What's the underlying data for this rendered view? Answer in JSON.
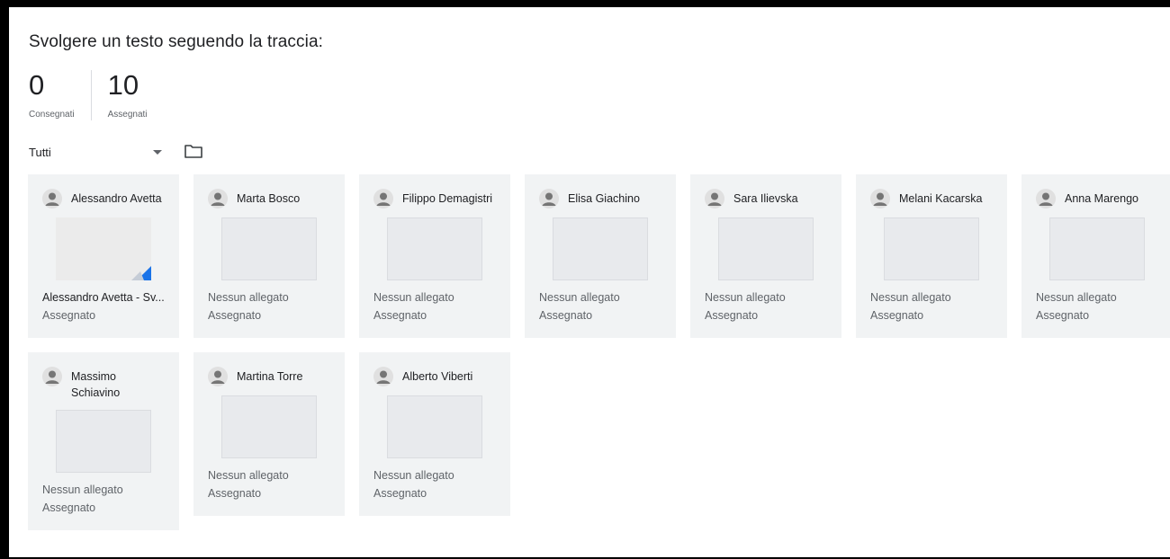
{
  "assignment": {
    "title": "Svolgere un testo seguendo la traccia:"
  },
  "stats": {
    "submitted": {
      "value": "0",
      "label": "Consegnati"
    },
    "assigned": {
      "value": "10",
      "label": "Assegnati"
    }
  },
  "filter": {
    "selected": "Tutti"
  },
  "students": [
    {
      "name": "Alessandro Avetta",
      "line1": "Alessandro Avetta - Sv...",
      "line2": "Assegnato",
      "has_doc": true
    },
    {
      "name": "Marta Bosco",
      "line1": "Nessun allegato",
      "line2": "Assegnato"
    },
    {
      "name": "Filippo Demagistri",
      "line1": "Nessun allegato",
      "line2": "Assegnato"
    },
    {
      "name": "Elisa Giachino",
      "line1": "Nessun allegato",
      "line2": "Assegnato"
    },
    {
      "name": "Sara Ilievska",
      "line1": "Nessun allegato",
      "line2": "Assegnato"
    },
    {
      "name": "Melani Kacarska",
      "line1": "Nessun allegato",
      "line2": "Assegnato"
    },
    {
      "name": "Anna Marengo",
      "line1": "Nessun allegato",
      "line2": "Assegnato"
    },
    {
      "name": "Massimo Schiavino",
      "line1": "Nessun allegato",
      "line2": "Assegnato"
    },
    {
      "name": "Martina Torre",
      "line1": "Nessun allegato",
      "line2": "Assegnato"
    },
    {
      "name": "Alberto Viberti",
      "line1": "Nessun allegato",
      "line2": "Assegnato"
    }
  ]
}
